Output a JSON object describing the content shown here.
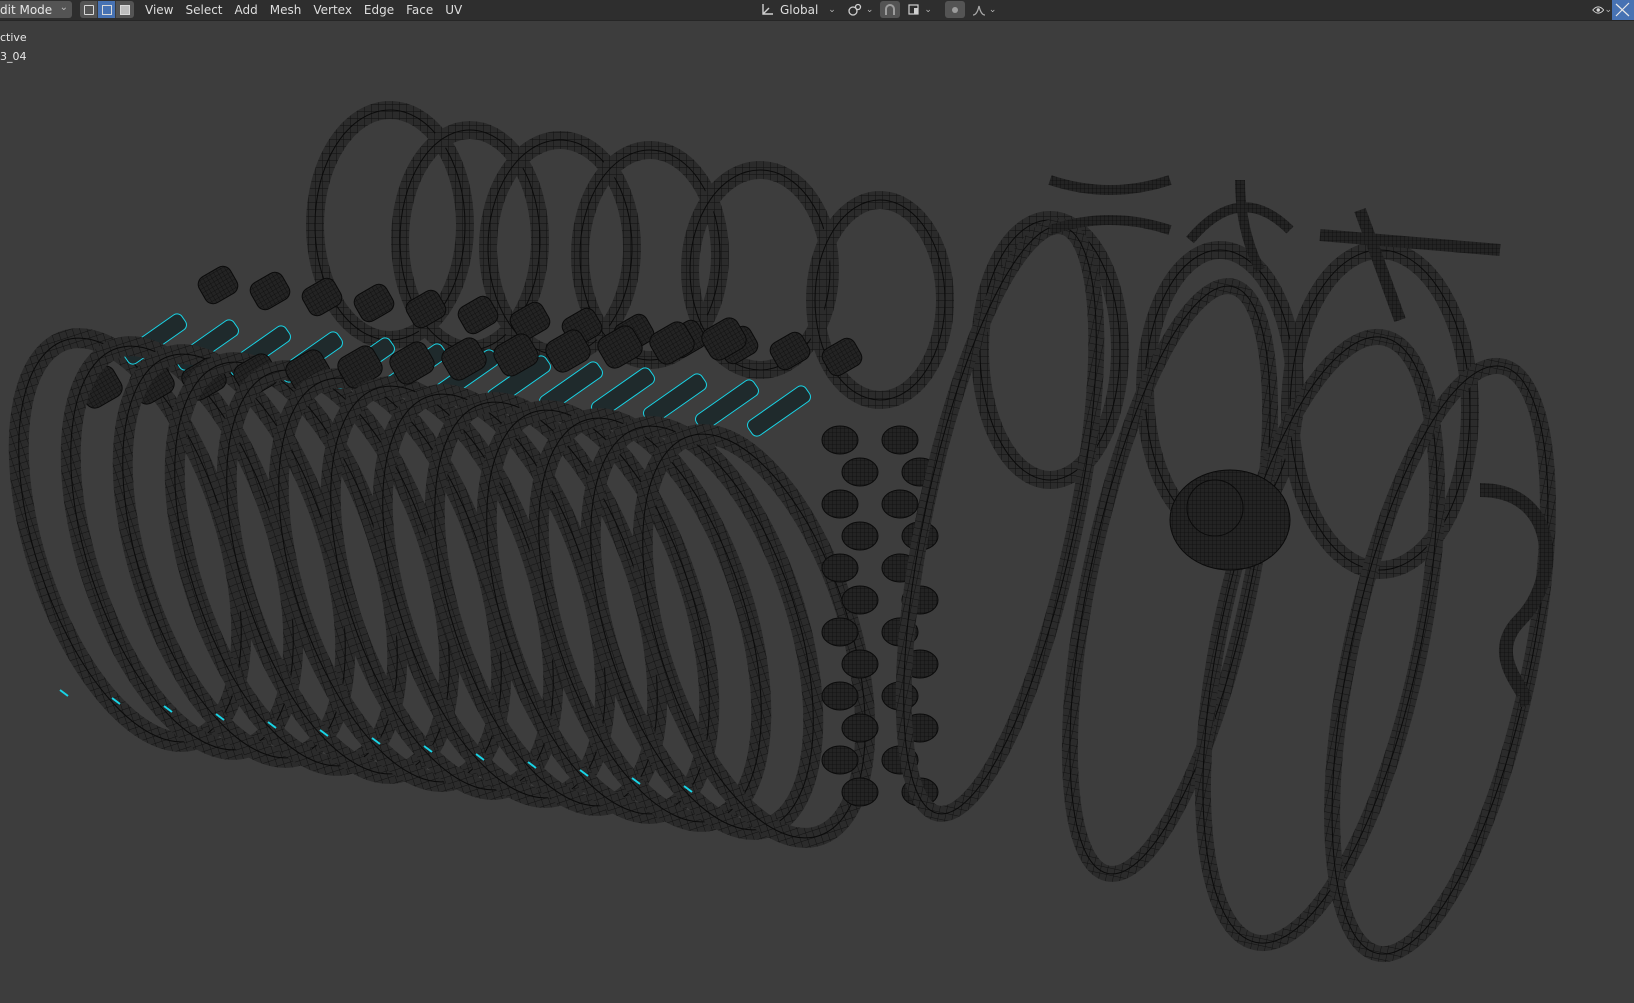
{
  "header": {
    "mode": {
      "label": "dit Mode",
      "icon": "chevron-down-icon"
    },
    "select_modes": [
      {
        "name": "vertex-select-icon",
        "active": false
      },
      {
        "name": "edge-select-icon",
        "active": true
      },
      {
        "name": "face-select-icon",
        "active": false
      }
    ],
    "menus": [
      "View",
      "Select",
      "Add",
      "Mesh",
      "Vertex",
      "Edge",
      "Face",
      "UV"
    ],
    "transform_orientation": {
      "label": "Global",
      "icon": "transform-orientation-icon"
    },
    "pivot_icon": "pivot-point-icon",
    "snap_icon": "magnet-snap-icon",
    "snap_target_icon": "snap-target-icon",
    "proportional_icon": "proportional-edit-icon",
    "falloff_icon": "falloff-curve-icon",
    "visibility_icon": "eye-icon"
  },
  "overlay": {
    "line1": "ctive",
    "line2": "3_04"
  },
  "colors": {
    "background": "#3d3d3d",
    "header": "#2e2e2e",
    "wire": "#0b0b0b",
    "mesh_fill": "#2b2b2b",
    "accent_edge": "#18d4e6",
    "active_button": "#4772b3"
  }
}
